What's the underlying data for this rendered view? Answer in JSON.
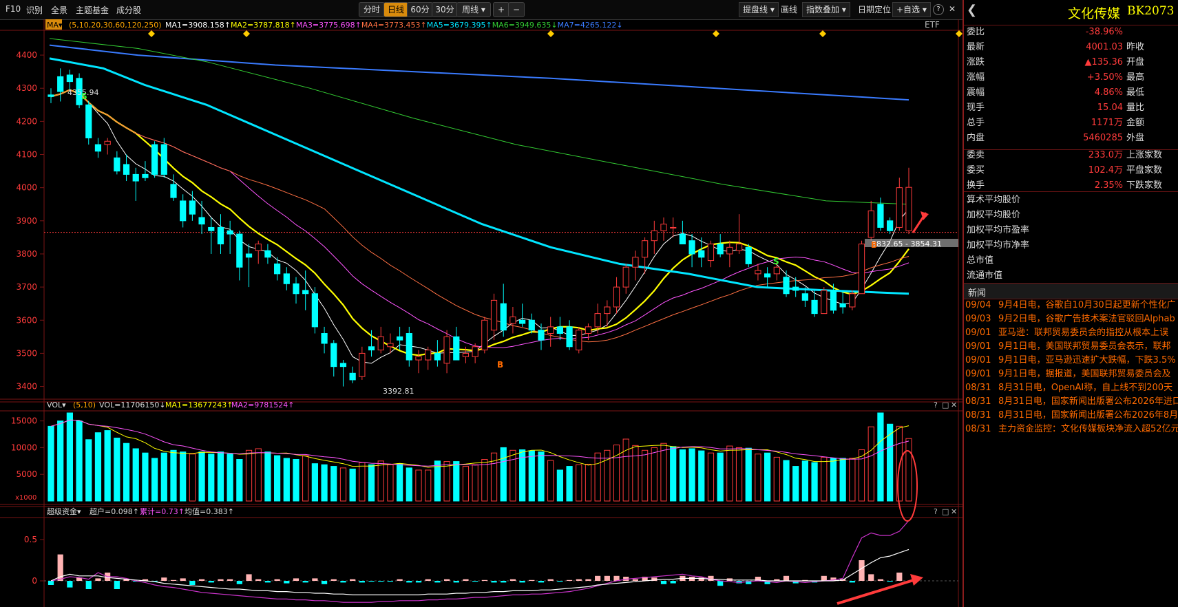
{
  "toolbar": {
    "f10": "F10",
    "shibie": "识别",
    "quanjing": "全景",
    "theme_fund": "主题基金",
    "members": "成分股",
    "periods": [
      "分时",
      "日线",
      "60分",
      "30分",
      "周线 ▾"
    ],
    "active_period": "日线",
    "zoom_in": "+",
    "zoom_out": "−",
    "draw_line": "提盘线 ▾",
    "huaxian": "画线",
    "index_overlay": "指数叠加 ▾",
    "date_locate": "日期定位",
    "add_watch": "+自选 ▾",
    "help": "?",
    "close": "✕"
  },
  "ma_legend": {
    "name": "MA▾",
    "params": "(5,10,20,30,60,120,250)",
    "items": [
      {
        "label": "MA1=3908.158↑",
        "color": "#ffffff"
      },
      {
        "label": "MA2=3787.818↑",
        "color": "#ffff00"
      },
      {
        "label": "MA3=3775.698↑",
        "color": "#ff55ff"
      },
      {
        "label": "MA4=3773.453↑",
        "color": "#ff7043"
      },
      {
        "label": "MA5=3679.395↑",
        "color": "#00e5ff"
      },
      {
        "label": "MA6=3949.635↓",
        "color": "#33cc33"
      },
      {
        "label": "MA7=4265.122↓",
        "color": "#3a7bff"
      }
    ],
    "etf": "ETF"
  },
  "vol_legend": {
    "name": "VOL▾",
    "params": "(5,10)",
    "vol": "VOL=11706150↓",
    "ma1": "MA1=13677243↑",
    "ma2": "MA2=9781524↑",
    "unit": "x1000"
  },
  "fund_legend": {
    "name": "超级资金▾",
    "chaohu": "超户=0.098↑",
    "leiji": "累计=0.73↑",
    "junzhi": "均值=0.383↑"
  },
  "panel_icons": [
    "?",
    "□",
    "✕"
  ],
  "price_labels": {
    "high": "4355.94",
    "low": "3392.81",
    "range": "3832.65 - 3854.31",
    "buy_mark": "B",
    "sell_mark": "S"
  },
  "right_panel": {
    "back": "❮",
    "name": "文化传媒",
    "code": "BK2073",
    "rows": [
      {
        "label": "委比",
        "value": "-38.96%",
        "label2": ""
      },
      {
        "label": "最新",
        "value": "4001.03",
        "label2": "昨收"
      },
      {
        "label": "涨跌",
        "value": "▲135.36",
        "label2": "开盘"
      },
      {
        "label": "涨幅",
        "value": "+3.50%",
        "label2": "最高"
      },
      {
        "label": "震幅",
        "value": "4.86%",
        "label2": "最低"
      },
      {
        "label": "现手",
        "value": "15.04",
        "label2": "量比"
      },
      {
        "label": "总手",
        "value": "1171万",
        "label2": "金额"
      },
      {
        "label": "内盘",
        "value": "5460285",
        "label2": "外盘"
      },
      {
        "label": "委卖",
        "value": "233.0万",
        "label2": "上涨家数"
      },
      {
        "label": "委买",
        "value": "102.4万",
        "label2": "平盘家数"
      },
      {
        "label": "换手",
        "value": "2.35%",
        "label2": "下跌家数"
      }
    ],
    "stats": [
      "算术平均股价",
      "加权平均股价",
      "加权平均市盈率",
      "加权平均市净率",
      "总市值",
      "流通市值"
    ],
    "news_title": "新闻",
    "news": [
      {
        "date": "09/04",
        "text": "9月4日电，谷歌自10月30日起更新个性化广"
      },
      {
        "date": "09/03",
        "text": "9月2日电，谷歌广告技术案法官驳回Alphab"
      },
      {
        "date": "09/01",
        "text": "亚马逊：联邦贸易委员会的指控从根本上误"
      },
      {
        "date": "09/01",
        "text": "9月1日电，美国联邦贸易委员会表示，联邦"
      },
      {
        "date": "09/01",
        "text": "9月1日电，亚马逊迅速扩大跌幅，下跌3.5%"
      },
      {
        "date": "09/01",
        "text": "9月1日电，据报道，美国联邦贸易委员会及"
      },
      {
        "date": "08/31",
        "text": "8月31日电，OpenAI称，自上线不到200天"
      },
      {
        "date": "08/31",
        "text": "8月31日电，国家新闻出版署公布2026年进口"
      },
      {
        "date": "08/31",
        "text": "8月31日电，国家新闻出版署公布2026年8月"
      },
      {
        "date": "08/31",
        "text": "主力资金监控：文化传媒板块净流入超52亿元"
      }
    ]
  },
  "chart_data": [
    {
      "type": "candlestick",
      "title": "",
      "y_ticks": [
        3400,
        3500,
        3600,
        3700,
        3800,
        3900,
        4000,
        4100,
        4200,
        4300,
        4400
      ],
      "ylim": [
        3370,
        4450
      ],
      "ohlc": [
        [
          4280,
          4300,
          4255,
          4275
        ],
        [
          4335,
          4360,
          4260,
          4290
        ],
        [
          4340,
          4356,
          4290,
          4320
        ],
        [
          4330,
          4345,
          4240,
          4250
        ],
        [
          4250,
          4262,
          4130,
          4150
        ],
        [
          4130,
          4150,
          4090,
          4110
        ],
        [
          4130,
          4150,
          4100,
          4140
        ],
        [
          4090,
          4110,
          4040,
          4050
        ],
        [
          4070,
          4100,
          4020,
          4040
        ],
        [
          4040,
          4060,
          3960,
          4020
        ],
        [
          4040,
          4080,
          4020,
          4030
        ],
        [
          4130,
          4140,
          4030,
          4040
        ],
        [
          4130,
          4150,
          4030,
          4040
        ],
        [
          4010,
          4040,
          3960,
          3970
        ],
        [
          3960,
          3980,
          3880,
          3900
        ],
        [
          3960,
          3990,
          3900,
          3920
        ],
        [
          3910,
          3960,
          3860,
          3890
        ],
        [
          3880,
          3910,
          3800,
          3870
        ],
        [
          3880,
          3920,
          3800,
          3830
        ],
        [
          3870,
          3900,
          3800,
          3860
        ],
        [
          3860,
          3870,
          3720,
          3760
        ],
        [
          3800,
          3830,
          3700,
          3790
        ],
        [
          3810,
          3840,
          3770,
          3830
        ],
        [
          3810,
          3830,
          3770,
          3790
        ],
        [
          3770,
          3790,
          3720,
          3740
        ],
        [
          3740,
          3760,
          3690,
          3710
        ],
        [
          3710,
          3730,
          3650,
          3680
        ],
        [
          3690,
          3750,
          3630,
          3680
        ],
        [
          3680,
          3700,
          3560,
          3580
        ],
        [
          3560,
          3580,
          3500,
          3530
        ],
        [
          3530,
          3540,
          3430,
          3460
        ],
        [
          3470,
          3480,
          3400,
          3460
        ],
        [
          3440,
          3460,
          3410,
          3420
        ],
        [
          3430,
          3520,
          3420,
          3500
        ],
        [
          3520,
          3570,
          3490,
          3510
        ],
        [
          3510,
          3580,
          3500,
          3550
        ],
        [
          3520,
          3560,
          3500,
          3530
        ],
        [
          3550,
          3580,
          3510,
          3540
        ],
        [
          3560,
          3580,
          3460,
          3480
        ],
        [
          3480,
          3510,
          3440,
          3490
        ],
        [
          3480,
          3520,
          3450,
          3510
        ],
        [
          3500,
          3540,
          3460,
          3480
        ],
        [
          3470,
          3570,
          3440,
          3550
        ],
        [
          3550,
          3580,
          3480,
          3480
        ],
        [
          3490,
          3520,
          3470,
          3500
        ],
        [
          3490,
          3530,
          3470,
          3520
        ],
        [
          3510,
          3610,
          3500,
          3600
        ],
        [
          3570,
          3680,
          3540,
          3660
        ],
        [
          3650,
          3710,
          3550,
          3570
        ],
        [
          3590,
          3640,
          3560,
          3610
        ],
        [
          3600,
          3650,
          3580,
          3590
        ],
        [
          3600,
          3620,
          3560,
          3570
        ],
        [
          3570,
          3590,
          3510,
          3540
        ],
        [
          3560,
          3610,
          3520,
          3580
        ],
        [
          3580,
          3610,
          3540,
          3560
        ],
        [
          3580,
          3600,
          3510,
          3520
        ],
        [
          3510,
          3580,
          3500,
          3570
        ],
        [
          3560,
          3590,
          3540,
          3580
        ],
        [
          3580,
          3650,
          3560,
          3620
        ],
        [
          3620,
          3660,
          3580,
          3640
        ],
        [
          3640,
          3730,
          3620,
          3700
        ],
        [
          3700,
          3770,
          3680,
          3760
        ],
        [
          3760,
          3810,
          3720,
          3790
        ],
        [
          3790,
          3850,
          3740,
          3840
        ],
        [
          3840,
          3900,
          3800,
          3870
        ],
        [
          3870,
          3910,
          3840,
          3890
        ],
        [
          3880,
          3910,
          3850,
          3880
        ],
        [
          3860,
          3900,
          3830,
          3830
        ],
        [
          3840,
          3860,
          3760,
          3800
        ],
        [
          3810,
          3850,
          3760,
          3790
        ],
        [
          3780,
          3840,
          3760,
          3830
        ],
        [
          3830,
          3860,
          3790,
          3800
        ],
        [
          3800,
          3840,
          3760,
          3820
        ],
        [
          3810,
          3920,
          3800,
          3830
        ],
        [
          3820,
          3830,
          3760,
          3770
        ],
        [
          3740,
          3770,
          3720,
          3750
        ],
        [
          3740,
          3760,
          3700,
          3730
        ],
        [
          3740,
          3780,
          3720,
          3760
        ],
        [
          3730,
          3750,
          3670,
          3680
        ],
        [
          3700,
          3730,
          3670,
          3690
        ],
        [
          3680,
          3700,
          3640,
          3660
        ],
        [
          3660,
          3690,
          3610,
          3620
        ],
        [
          3620,
          3700,
          3620,
          3690
        ],
        [
          3690,
          3710,
          3620,
          3630
        ],
        [
          3650,
          3690,
          3620,
          3640
        ],
        [
          3640,
          3690,
          3630,
          3680
        ],
        [
          3680,
          3840,
          3680,
          3830
        ],
        [
          3850,
          3960,
          3840,
          3930
        ],
        [
          3950,
          3970,
          3870,
          3880
        ],
        [
          3900,
          3910,
          3860,
          3870
        ],
        [
          3880,
          4030,
          3870,
          4000
        ],
        [
          3870,
          4060,
          3860,
          4001
        ]
      ],
      "ma_colors": [
        "#ffffff",
        "#ffff00",
        "#ff55ff",
        "#ff7043",
        "#00e5ff",
        "#33cc33",
        "#3a7bff"
      ]
    },
    {
      "type": "bar",
      "title": "",
      "y_ticks": [
        5000,
        10000,
        15000
      ],
      "ylim": [
        0,
        16500
      ],
      "values": [
        14000,
        15000,
        16500,
        15000,
        11500,
        12800,
        13200,
        11800,
        10800,
        9800,
        9000,
        8000,
        9000,
        9500,
        9200,
        8800,
        9200,
        8800,
        9200,
        8800,
        7800,
        9500,
        9800,
        9200,
        8500,
        8000,
        7800,
        8500,
        7000,
        6800,
        6500,
        6200,
        6000,
        7200,
        6800,
        7500,
        6800,
        7000,
        6200,
        5800,
        5800,
        7500,
        7400,
        7400,
        6500,
        6800,
        7800,
        9000,
        10000,
        9500,
        9600,
        9400,
        9200,
        7600,
        5800,
        6500,
        6800,
        6900,
        9000,
        9500,
        10500,
        11600,
        10400,
        9500,
        10000,
        10800,
        10200,
        9600,
        9800,
        9400,
        9000,
        9000,
        10300,
        10000,
        9900,
        8800,
        9000,
        8200,
        7600,
        6500,
        7500,
        7200,
        8200,
        8000,
        8000,
        8000,
        9600,
        13900,
        16500,
        14400,
        14000,
        11700
      ],
      "bull": [
        false,
        false,
        false,
        false,
        false,
        false,
        false,
        false,
        false,
        false,
        false,
        false,
        false,
        false,
        false,
        true,
        false,
        false,
        false,
        false,
        false,
        true,
        true,
        false,
        false,
        false,
        false,
        true,
        false,
        false,
        false,
        true,
        false,
        true,
        false,
        true,
        true,
        false,
        false,
        true,
        true,
        false,
        true,
        false,
        true,
        true,
        true,
        true,
        false,
        true,
        false,
        false,
        false,
        true,
        false,
        false,
        true,
        true,
        true,
        true,
        true,
        true,
        true,
        true,
        true,
        true,
        false,
        false,
        false,
        false,
        true,
        false,
        true,
        true,
        false,
        true,
        false,
        true,
        false,
        false,
        false,
        false,
        true,
        false,
        false,
        true,
        true,
        true,
        false,
        false,
        true,
        true
      ]
    },
    {
      "type": "bar",
      "title": "",
      "y_ticks": [
        0.0,
        0.5
      ],
      "ylim": [
        -0.3,
        0.75
      ],
      "values": [
        -0.05,
        0.32,
        -0.08,
        0.04,
        -0.1,
        0.03,
        0.1,
        -0.1,
        0.02,
        -0.01,
        0.02,
        -0.01,
        0.04,
        0.01,
        0.03,
        -0.05,
        0.02,
        -0.02,
        0.02,
        0.02,
        -0.04,
        0.08,
        0.02,
        -0.02,
        0.02,
        -0.03,
        0.03,
        -0.02,
        0.03,
        -0.04,
        0.02,
        -0.02,
        0.02,
        -0.02,
        -0.01,
        -0.01,
        -0.01,
        0.02,
        -0.02,
        -0.02,
        0.02,
        -0.02,
        0.02,
        -0.02,
        0.02,
        -0.01,
        0.01,
        -0.02,
        -0.02,
        0.02,
        -0.02,
        0.01,
        -0.02,
        0.02,
        -0.01,
        0.01,
        0.02,
        0.02,
        0.06,
        0.06,
        0.06,
        0.05,
        0.02,
        0.05,
        0.04,
        -0.04,
        -0.03,
        0.06,
        0.05,
        0.04,
        0.06,
        -0.06,
        0.03,
        -0.03,
        -0.04,
        0.05,
        -0.04,
        0.02,
        0.06,
        -0.03,
        0.01,
        -0.02,
        0.06,
        0.04,
        0.02,
        -0.02,
        0.25,
        0.08,
        0.02,
        -0.01,
        0.1
      ],
      "line1": [
        0.0,
        0.02,
        0.05,
        0.04,
        0.02,
        0.1,
        0.05,
        0.05,
        0.03,
        0.0,
        -0.02,
        -0.05,
        -0.07,
        -0.08,
        -0.1,
        -0.12,
        -0.14,
        -0.15,
        -0.16,
        -0.17,
        -0.18,
        -0.19,
        -0.2,
        -0.21,
        -0.22,
        -0.22,
        -0.23,
        -0.23,
        -0.24,
        -0.24,
        -0.25,
        -0.26,
        -0.26,
        -0.26,
        -0.26,
        -0.25,
        -0.25,
        -0.24,
        -0.24,
        -0.24,
        -0.23,
        -0.23,
        -0.22,
        -0.22,
        -0.21,
        -0.2,
        -0.2,
        -0.19,
        -0.18,
        -0.17,
        -0.17,
        -0.16,
        -0.16,
        -0.15,
        -0.14,
        -0.13,
        -0.11,
        -0.09,
        -0.06,
        -0.03,
        0.0,
        0.02,
        0.03,
        0.04,
        0.05,
        0.06,
        0.07,
        0.08,
        0.06,
        0.05,
        0.02,
        0.0,
        -0.01,
        -0.02,
        -0.01,
        0.0,
        -0.01,
        -0.02,
        0.0,
        -0.01,
        -0.02,
        -0.01,
        0.0,
        0.01,
        0.03,
        0.28,
        0.52,
        0.58,
        0.55,
        0.55,
        0.6,
        0.73
      ],
      "line2": [
        0.0,
        0.05,
        0.08,
        0.06,
        0.06,
        0.06,
        0.04,
        0.03,
        0.02,
        0.01,
        0.0,
        -0.01,
        -0.03,
        -0.04,
        -0.05,
        -0.06,
        -0.07,
        -0.08,
        -0.09,
        -0.1,
        -0.1,
        -0.11,
        -0.12,
        -0.12,
        -0.13,
        -0.13,
        -0.14,
        -0.14,
        -0.15,
        -0.15,
        -0.16,
        -0.16,
        -0.17,
        -0.17,
        -0.17,
        -0.17,
        -0.17,
        -0.17,
        -0.17,
        -0.17,
        -0.16,
        -0.16,
        -0.16,
        -0.15,
        -0.15,
        -0.14,
        -0.14,
        -0.13,
        -0.13,
        -0.12,
        -0.12,
        -0.12,
        -0.11,
        -0.11,
        -0.1,
        -0.09,
        -0.08,
        -0.07,
        -0.05,
        -0.04,
        -0.03,
        -0.02,
        -0.01,
        0.0,
        0.01,
        0.02,
        0.02,
        0.03,
        0.03,
        0.03,
        0.02,
        0.02,
        0.01,
        0.01,
        0.01,
        0.01,
        0.0,
        0.0,
        0.0,
        0.0,
        0.0,
        0.0,
        0.0,
        0.0,
        0.01,
        0.08,
        0.15,
        0.22,
        0.28,
        0.3,
        0.34,
        0.38
      ]
    }
  ]
}
